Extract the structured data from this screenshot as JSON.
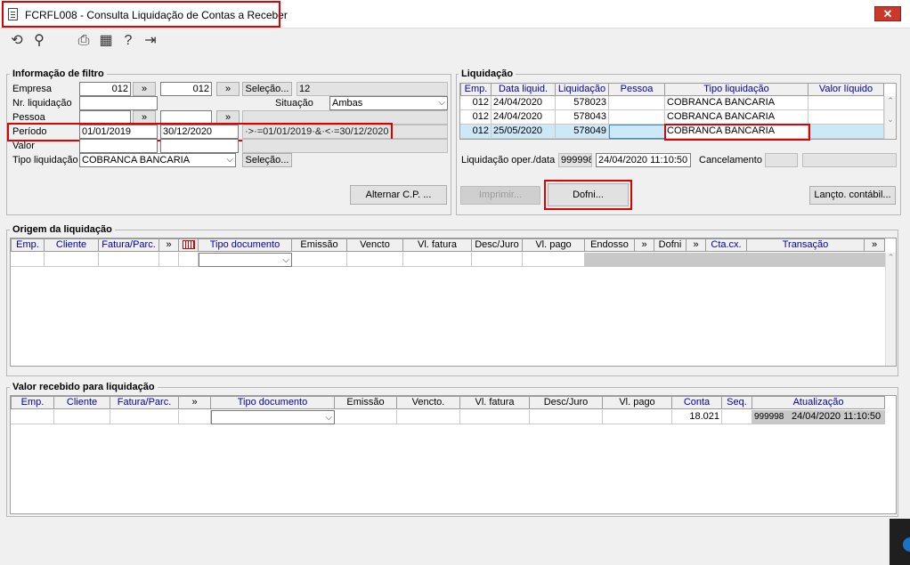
{
  "window": {
    "title": "FCRFL008 - Consulta Liquidação de Contas a Receber",
    "close": "✕"
  },
  "toolbar": {
    "icons": [
      "refresh-icon",
      "search-icon",
      "print-icon",
      "calendar-icon",
      "help-icon",
      "exit-icon"
    ]
  },
  "filtro": {
    "group_label": "Informação de filtro",
    "empresa_label": "Empresa",
    "empresa_de": "012",
    "empresa_ate": "012",
    "selecao_label": "Seleção...",
    "empresa_desc": "12",
    "nr_liquidacao_label": "Nr. liquidação",
    "situacao_label": "Situação",
    "situacao_value": "Ambas",
    "pessoa_label": "Pessoa",
    "periodo_label": "Período",
    "periodo_de": "01/01/2019",
    "periodo_ate": "30/12/2020",
    "periodo_expr": "·>·=01/01/2019·&·<·=30/12/2020",
    "valor_label": "Valor",
    "tipo_liquidacao_label": "Tipo liquidação",
    "tipo_liquidacao_value": "COBRANCA BANCARIA",
    "selecao2_label": "Seleção...",
    "alternar_label": "Alternar C.P. ...",
    "range_btn": "»"
  },
  "liquidacao": {
    "group_label": "Liquidação",
    "headers": [
      "Emp.",
      "Data liquid.",
      "Liquidação",
      "Pessoa",
      "Tipo liquidação",
      "Valor líquido"
    ],
    "rows": [
      [
        "012",
        "24/04/2020",
        "578023",
        "",
        "COBRANCA BANCARIA",
        ""
      ],
      [
        "012",
        "24/04/2020",
        "578043",
        "",
        "COBRANCA BANCARIA",
        ""
      ],
      [
        "012",
        "25/05/2020",
        "578049",
        "",
        "COBRANCA BANCARIA",
        ""
      ]
    ],
    "oper_label": "Liquidação oper./data",
    "oper_value": "999998",
    "oper_data": "24/04/2020 11:10:50",
    "cancelamento_label": "Cancelamento",
    "imprimir_label": "Imprimir...",
    "dofni_label": "Dofni...",
    "lancto_label": "Lançto. contábil..."
  },
  "origem": {
    "group_label": "Origem da liquidação",
    "headers": [
      "Emp.",
      "Cliente",
      "Fatura/Parc.",
      "»",
      "",
      "Tipo documento",
      "Emissão",
      "Vencto",
      "Vl. fatura",
      "Desc/Juro",
      "Vl. pago",
      "Endosso",
      "»",
      "Dofni",
      "»",
      "Cta.cx.",
      "Transação",
      "»"
    ]
  },
  "valor_recebido": {
    "group_label": "Valor recebido para liquidação",
    "headers": [
      "Emp.",
      "Cliente",
      "Fatura/Parc.",
      "»",
      "Tipo documento",
      "Emissão",
      "Vencto.",
      "Vl. fatura",
      "Desc/Juro",
      "Vl. pago",
      "Conta",
      "Seq.",
      "Atualização"
    ],
    "conta": "18.021",
    "atualizacao_user": "999998",
    "atualizacao_data": "24/04/2020 11:10:50"
  },
  "colors": {
    "highlight": "#e00000",
    "header_text": "#0000a8",
    "selected_row": "#cde8f7"
  }
}
